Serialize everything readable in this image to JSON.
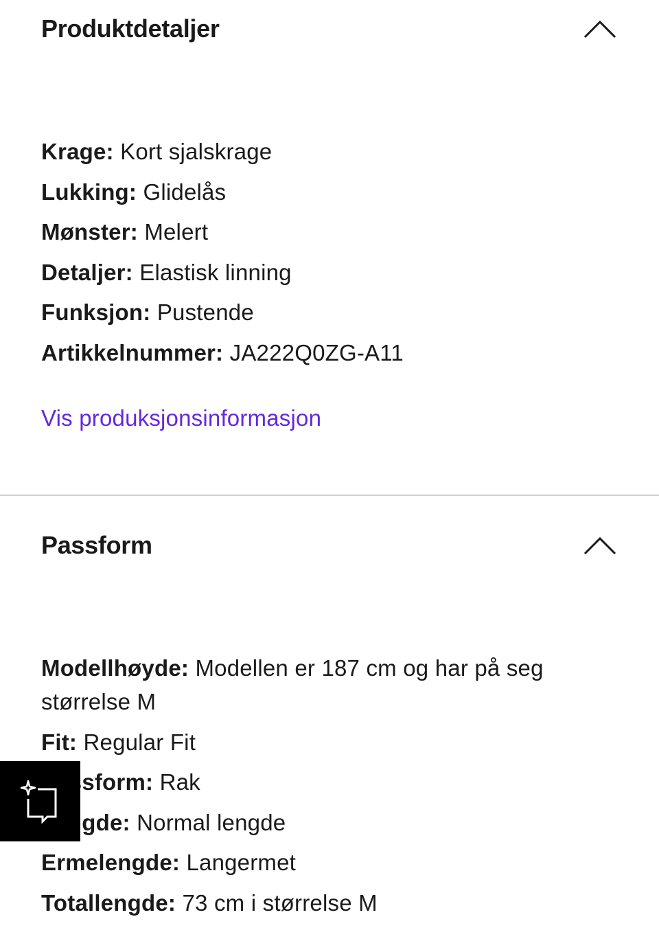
{
  "product_details": {
    "title": "Produktdetaljer",
    "attributes": [
      {
        "key": "Krage:",
        "value": "Kort sjalskrage"
      },
      {
        "key": "Lukking:",
        "value": "Glidelås"
      },
      {
        "key": "Mønster:",
        "value": "Melert"
      },
      {
        "key": "Detaljer:",
        "value": "Elastisk linning"
      },
      {
        "key": "Funksjon:",
        "value": "Pustende"
      },
      {
        "key": "Artikkelnummer:",
        "value": "JA222Q0ZG-A11"
      }
    ],
    "link_label": "Vis produksjonsinformasjon",
    "expanded_icon": "chevron-up-icon"
  },
  "fit": {
    "title": "Passform",
    "attributes": [
      {
        "key": "Modellhøyde:",
        "value": "Modellen er 187 cm og har på seg størrelse M"
      },
      {
        "key": "Fit:",
        "value": "Regular Fit"
      },
      {
        "key": "Passform:",
        "value": "Rak"
      },
      {
        "key": "Lengde:",
        "value": "Normal lengde"
      },
      {
        "key": "Ermelengde:",
        "value": "Langermet"
      },
      {
        "key": "Totallengde:",
        "value": "73 cm i størrelse M"
      }
    ],
    "expanded_icon": "chevron-up-icon"
  },
  "floating_button": {
    "icon": "ai-sparkle-chat-icon"
  },
  "colors": {
    "link": "#6328e0",
    "text": "#1a1a1a",
    "divider": "#d0d0d0",
    "floating_button_bg": "#000000"
  }
}
